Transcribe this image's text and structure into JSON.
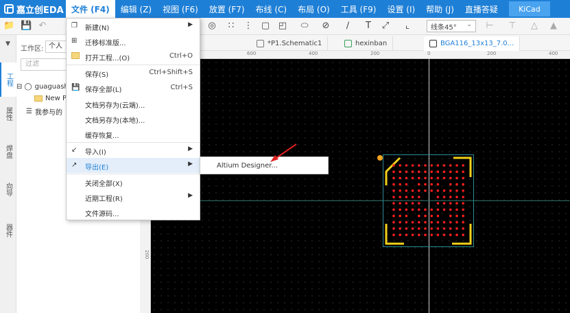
{
  "menubar": {
    "logo_text": "嘉立创EDA",
    "items": [
      "文件 (F4)",
      "编辑 (Z)",
      "视图 (F6)",
      "放置 (F7)",
      "布线 (C)",
      "布局 (O)",
      "工具 (F9)",
      "设置 (I)",
      "帮助 (J)",
      "直播答疑"
    ],
    "kicad_label": "KiCad"
  },
  "toolbar": {
    "linestyle": "线条45°"
  },
  "left_tabs": [
    "工程",
    "属性",
    "焊盘",
    "向导",
    "器件"
  ],
  "left_panel": {
    "workspace_label": "工作区:",
    "workspace_value": "个人",
    "filter_placeholder": "过滤",
    "tree": {
      "user": "guaguash",
      "project": "New Pr",
      "participated": "我参与的"
    }
  },
  "doc_tabs": [
    "*P1.Schematic1",
    "hexinban",
    "BGA116_13x13_7.0..."
  ],
  "ruler": {
    "h_ticks": [
      "600",
      "400",
      "200",
      "0",
      "200",
      "400",
      "600"
    ],
    "v_tick": "200"
  },
  "file_menu": {
    "items": [
      {
        "label": "新建(N)",
        "shortcut": "",
        "submenu": true
      },
      {
        "label": "迁移标准版...",
        "shortcut": "",
        "submenu": false
      },
      {
        "label": "打开工程...(O)",
        "shortcut": "Ctrl+O",
        "submenu": false
      },
      {
        "label": "保存(S)",
        "shortcut": "Ctrl+Shift+S",
        "submenu": false
      },
      {
        "label": "保存全部(L)",
        "shortcut": "Ctrl+S",
        "submenu": false
      },
      {
        "label": "文档另存为(云端)...",
        "shortcut": "",
        "submenu": false
      },
      {
        "label": "文档另存为(本地)...",
        "shortcut": "",
        "submenu": false
      },
      {
        "label": "缓存恢复...",
        "shortcut": "",
        "submenu": false
      },
      {
        "label": "导入(I)",
        "shortcut": "",
        "submenu": true
      },
      {
        "label": "导出(E)",
        "shortcut": "",
        "submenu": true
      },
      {
        "label": "关闭全部(X)",
        "shortcut": "",
        "submenu": false
      },
      {
        "label": "近期工程(R)",
        "shortcut": "",
        "submenu": true
      },
      {
        "label": "文件源码...",
        "shortcut": "",
        "submenu": false
      }
    ]
  },
  "export_submenu": {
    "items": [
      "Altium Designer..."
    ]
  },
  "colors": {
    "menubar_bg": "#1e7fd6",
    "canvas_bg": "#000000",
    "pad": "#ff1e1e",
    "silkscreen": "#f2d11a",
    "outline": "#2c8f9a",
    "accent": "#1e7fd6"
  }
}
